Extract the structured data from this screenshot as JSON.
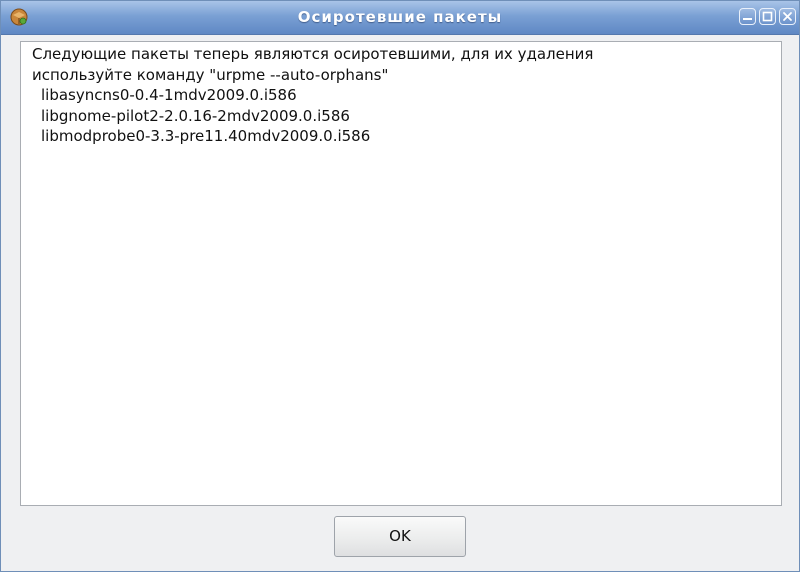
{
  "window": {
    "title": "Осиротевшие пакеты",
    "app_icon": "package-icon",
    "controls": [
      "minimize-icon",
      "maximize-icon",
      "close-icon"
    ]
  },
  "message": {
    "lines": [
      "Следующие пакеты теперь являются осиротевшими, для их удаления",
      "используйте команду \"urpme --auto-orphans\""
    ],
    "packages": [
      "libasyncns0-0.4-1mdv2009.0.i586",
      "libgnome-pilot2-2.0.16-2mdv2009.0.i586",
      "libmodprobe0-3.3-pre11.40mdv2009.0.i586"
    ]
  },
  "buttons": {
    "ok_label": "OK"
  },
  "colors": {
    "titlebar": "#7aa0d4",
    "window_bg": "#eff0f2"
  }
}
